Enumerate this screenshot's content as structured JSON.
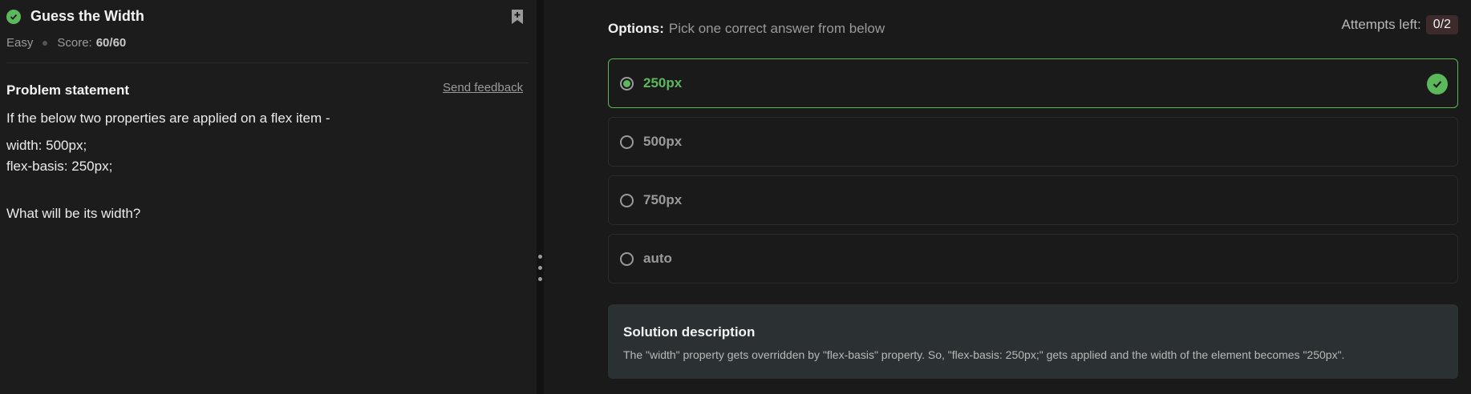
{
  "problem": {
    "title": "Guess the Width",
    "difficulty": "Easy",
    "score_label": "Score:",
    "score_value": "60/60",
    "heading": "Problem statement",
    "feedback_link": "Send feedback",
    "statement_lines": [
      "If the below two properties are applied on a flex item -",
      "width: 500px;",
      "flex-basis: 250px;",
      "What will be its width?"
    ]
  },
  "options_panel": {
    "label": "Options:",
    "instruction": "Pick one correct answer from below",
    "attempts_label": "Attempts left:",
    "attempts_value": "0/2",
    "options": [
      {
        "label": "250px",
        "selected": true,
        "correct": true
      },
      {
        "label": "500px",
        "selected": false,
        "correct": false
      },
      {
        "label": "750px",
        "selected": false,
        "correct": false
      },
      {
        "label": "auto",
        "selected": false,
        "correct": false
      }
    ]
  },
  "solution": {
    "title": "Solution description",
    "text": "The \"width\" property gets overridden by \"flex-basis\" property. So, \"flex-basis: 250px;\" gets applied and the width of the element becomes \"250px\"."
  },
  "colors": {
    "accent_green": "#5cb85c",
    "attempts_badge_bg": "#3d2a2a",
    "solution_bg": "#2b3132"
  },
  "icons": [
    "check-circle-icon",
    "bookmark-plus-icon",
    "radio-icon",
    "drag-handle-icon"
  ]
}
